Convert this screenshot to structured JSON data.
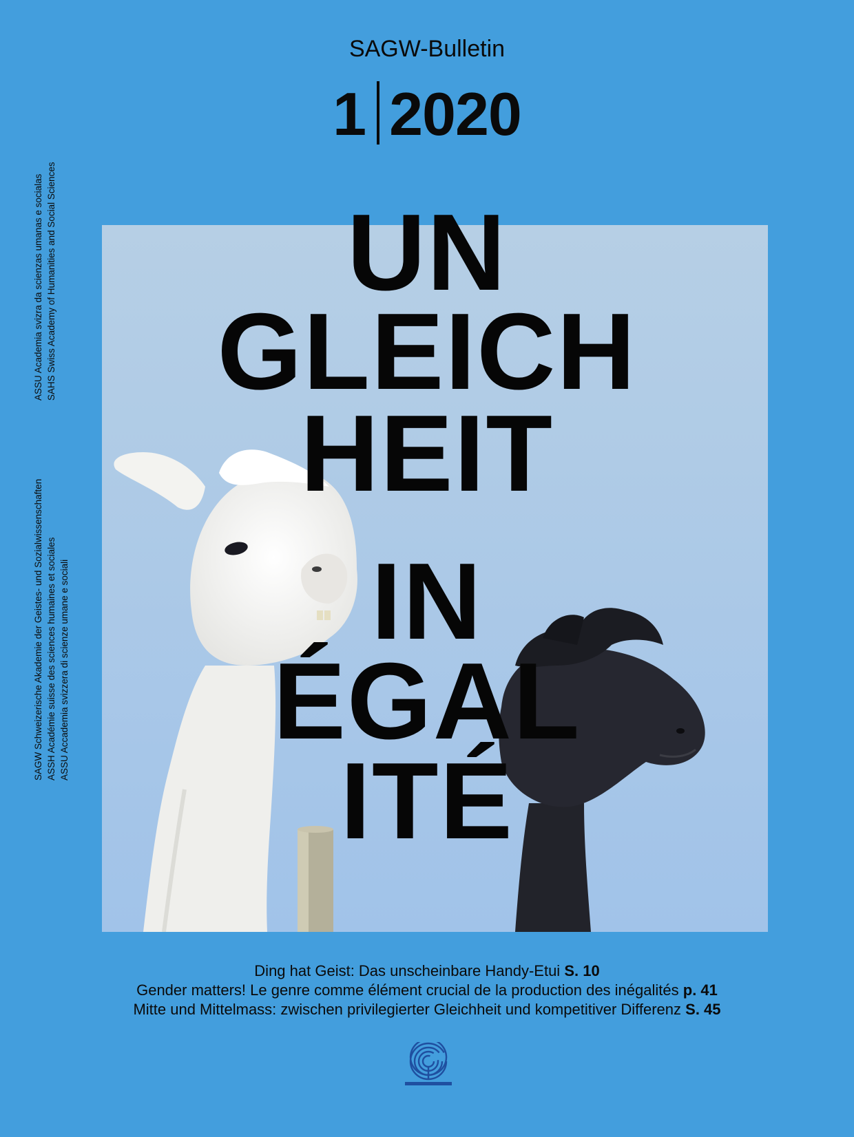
{
  "header": {
    "bulletin": "SAGW-Bulletin",
    "issue_number": "1",
    "issue_year": "2020"
  },
  "title": {
    "de_lines": [
      "UN",
      "GLEICH",
      "HEIT"
    ],
    "fr_lines": [
      "IN",
      "ÉGAL",
      "ITÉ"
    ]
  },
  "side_text": {
    "upper": [
      "ASSU Academia svizra da scienzas umanas e socialas",
      "SAHS Swiss Academy of Humanities and Social Sciences"
    ],
    "lower": [
      "SAGW Schweizerische Akademie der Geistes- und Sozialwissenschaften",
      "ASSH Académie suisse des sciences humaines et sociales",
      "ASSU Accademia svizzera di scienze umane e sociali"
    ]
  },
  "contents": [
    {
      "text": "Ding hat Geist: Das unscheinbare Handy-Etui",
      "page": "S. 10"
    },
    {
      "text": "Gender matters! Le genre comme élément crucial de la production des inégalités",
      "page": "p. 41"
    },
    {
      "text": "Mitte und Mittelmass: zwischen privilegierter Gleichheit und kompetitiver Differenz",
      "page": "S. 45"
    }
  ],
  "colors": {
    "background": "#439edd",
    "sky": "#a9c7e6",
    "logo": "#1f4fa0"
  },
  "icons": {
    "logo": "labyrinth-logo-icon"
  }
}
